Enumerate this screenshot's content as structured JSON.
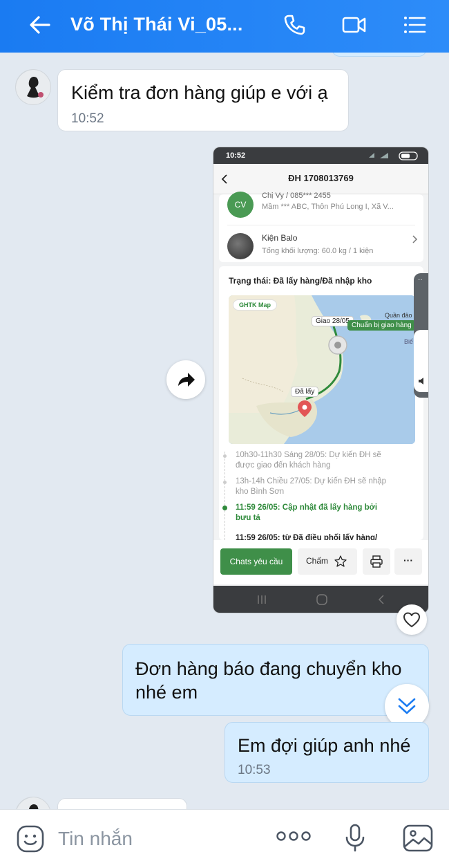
{
  "header": {
    "title": "Võ Thị Thái Vi_05...",
    "back_icon": "arrow-left-icon",
    "call_icon": "phone-icon",
    "video_icon": "video-icon",
    "menu_icon": "list-menu-icon"
  },
  "messages": {
    "incoming_1": {
      "text": "Kiểm tra đơn hàng giúp e với ạ",
      "time": "10:52"
    },
    "outgoing_1": {
      "text_line1": "Đơn hàng báo đang chuyển kho",
      "text_line2": "nhé em"
    },
    "outgoing_2": {
      "text": "Em đợi giúp anh nhé",
      "time": "10:53"
    }
  },
  "screenshot": {
    "status_time": "10:52",
    "order_title": "ĐH 1708013769",
    "receiver_avatar": "CV",
    "receiver_partial": "Chị Vy / 085*** 2455",
    "receiver_address": "Mầm *** ABC, Thôn Phú Long I, Xã V...",
    "package_name": "Kiện Balo",
    "package_weight": "Tổng khối lượng: 60.0 kg / 1 kiện",
    "status_label": "Trạng thái: Đã lấy hàng/Đã nhập kho",
    "map": {
      "badge": "GHTK Map",
      "pin_deliver": "Giao 28/05",
      "pin_prepare": "Chuẩn bị giao hàng",
      "pin_picked": "Đã lấy",
      "place_1": "Quần đảo",
      "place_2": "Biể"
    },
    "timeline": [
      {
        "line1": "10h30-11h30 Sáng 28/05: Dự kiến ĐH sẽ",
        "line2": "được giao đến khách hàng"
      },
      {
        "line1": "13h-14h Chiều 27/05: Dự kiến ĐH sẽ nhập",
        "line2": "kho Bình Sơn"
      },
      {
        "line1": "11:59 26/05: Cập nhật đã lấy hàng bởi",
        "line2": "bưu tá"
      },
      {
        "line1": "11:59 26/05: từ Đã điều phối lấy hàng/",
        "line2": ""
      }
    ],
    "chat_button": "Chats yêu cầu",
    "rate_button": "Chấm",
    "more_label": "···"
  },
  "composer": {
    "placeholder": "Tin nhắn",
    "emoji_icon": "emoji-icon",
    "more_icon": "more-dots-icon",
    "mic_icon": "microphone-icon",
    "image_icon": "image-icon"
  },
  "colors": {
    "header": "#1a7bf2",
    "outgoing_bubble": "#d5ecff",
    "ghtk_green": "#2f8a3b",
    "background": "#e2e9f1"
  }
}
